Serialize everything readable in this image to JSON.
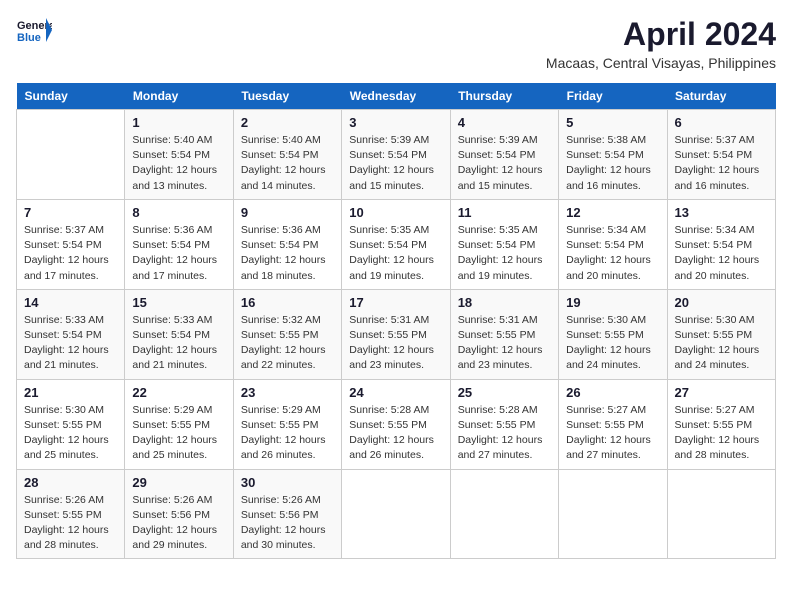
{
  "header": {
    "logo_line1": "General",
    "logo_line2": "Blue",
    "month": "April 2024",
    "location": "Macaas, Central Visayas, Philippines"
  },
  "weekdays": [
    "Sunday",
    "Monday",
    "Tuesday",
    "Wednesday",
    "Thursday",
    "Friday",
    "Saturday"
  ],
  "weeks": [
    [
      {
        "num": "",
        "info": ""
      },
      {
        "num": "1",
        "info": "Sunrise: 5:40 AM\nSunset: 5:54 PM\nDaylight: 12 hours\nand 13 minutes."
      },
      {
        "num": "2",
        "info": "Sunrise: 5:40 AM\nSunset: 5:54 PM\nDaylight: 12 hours\nand 14 minutes."
      },
      {
        "num": "3",
        "info": "Sunrise: 5:39 AM\nSunset: 5:54 PM\nDaylight: 12 hours\nand 15 minutes."
      },
      {
        "num": "4",
        "info": "Sunrise: 5:39 AM\nSunset: 5:54 PM\nDaylight: 12 hours\nand 15 minutes."
      },
      {
        "num": "5",
        "info": "Sunrise: 5:38 AM\nSunset: 5:54 PM\nDaylight: 12 hours\nand 16 minutes."
      },
      {
        "num": "6",
        "info": "Sunrise: 5:37 AM\nSunset: 5:54 PM\nDaylight: 12 hours\nand 16 minutes."
      }
    ],
    [
      {
        "num": "7",
        "info": "Sunrise: 5:37 AM\nSunset: 5:54 PM\nDaylight: 12 hours\nand 17 minutes."
      },
      {
        "num": "8",
        "info": "Sunrise: 5:36 AM\nSunset: 5:54 PM\nDaylight: 12 hours\nand 17 minutes."
      },
      {
        "num": "9",
        "info": "Sunrise: 5:36 AM\nSunset: 5:54 PM\nDaylight: 12 hours\nand 18 minutes."
      },
      {
        "num": "10",
        "info": "Sunrise: 5:35 AM\nSunset: 5:54 PM\nDaylight: 12 hours\nand 19 minutes."
      },
      {
        "num": "11",
        "info": "Sunrise: 5:35 AM\nSunset: 5:54 PM\nDaylight: 12 hours\nand 19 minutes."
      },
      {
        "num": "12",
        "info": "Sunrise: 5:34 AM\nSunset: 5:54 PM\nDaylight: 12 hours\nand 20 minutes."
      },
      {
        "num": "13",
        "info": "Sunrise: 5:34 AM\nSunset: 5:54 PM\nDaylight: 12 hours\nand 20 minutes."
      }
    ],
    [
      {
        "num": "14",
        "info": "Sunrise: 5:33 AM\nSunset: 5:54 PM\nDaylight: 12 hours\nand 21 minutes."
      },
      {
        "num": "15",
        "info": "Sunrise: 5:33 AM\nSunset: 5:54 PM\nDaylight: 12 hours\nand 21 minutes."
      },
      {
        "num": "16",
        "info": "Sunrise: 5:32 AM\nSunset: 5:55 PM\nDaylight: 12 hours\nand 22 minutes."
      },
      {
        "num": "17",
        "info": "Sunrise: 5:31 AM\nSunset: 5:55 PM\nDaylight: 12 hours\nand 23 minutes."
      },
      {
        "num": "18",
        "info": "Sunrise: 5:31 AM\nSunset: 5:55 PM\nDaylight: 12 hours\nand 23 minutes."
      },
      {
        "num": "19",
        "info": "Sunrise: 5:30 AM\nSunset: 5:55 PM\nDaylight: 12 hours\nand 24 minutes."
      },
      {
        "num": "20",
        "info": "Sunrise: 5:30 AM\nSunset: 5:55 PM\nDaylight: 12 hours\nand 24 minutes."
      }
    ],
    [
      {
        "num": "21",
        "info": "Sunrise: 5:30 AM\nSunset: 5:55 PM\nDaylight: 12 hours\nand 25 minutes."
      },
      {
        "num": "22",
        "info": "Sunrise: 5:29 AM\nSunset: 5:55 PM\nDaylight: 12 hours\nand 25 minutes."
      },
      {
        "num": "23",
        "info": "Sunrise: 5:29 AM\nSunset: 5:55 PM\nDaylight: 12 hours\nand 26 minutes."
      },
      {
        "num": "24",
        "info": "Sunrise: 5:28 AM\nSunset: 5:55 PM\nDaylight: 12 hours\nand 26 minutes."
      },
      {
        "num": "25",
        "info": "Sunrise: 5:28 AM\nSunset: 5:55 PM\nDaylight: 12 hours\nand 27 minutes."
      },
      {
        "num": "26",
        "info": "Sunrise: 5:27 AM\nSunset: 5:55 PM\nDaylight: 12 hours\nand 27 minutes."
      },
      {
        "num": "27",
        "info": "Sunrise: 5:27 AM\nSunset: 5:55 PM\nDaylight: 12 hours\nand 28 minutes."
      }
    ],
    [
      {
        "num": "28",
        "info": "Sunrise: 5:26 AM\nSunset: 5:55 PM\nDaylight: 12 hours\nand 28 minutes."
      },
      {
        "num": "29",
        "info": "Sunrise: 5:26 AM\nSunset: 5:56 PM\nDaylight: 12 hours\nand 29 minutes."
      },
      {
        "num": "30",
        "info": "Sunrise: 5:26 AM\nSunset: 5:56 PM\nDaylight: 12 hours\nand 30 minutes."
      },
      {
        "num": "",
        "info": ""
      },
      {
        "num": "",
        "info": ""
      },
      {
        "num": "",
        "info": ""
      },
      {
        "num": "",
        "info": ""
      }
    ]
  ]
}
